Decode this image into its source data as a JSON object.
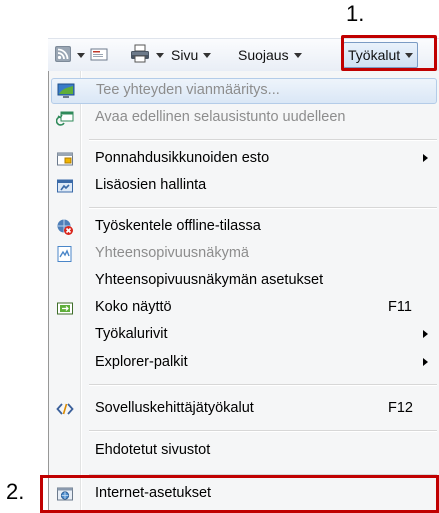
{
  "annotations": {
    "step1": "1.",
    "step2": "2."
  },
  "toolbar": {
    "rss_icon": "feeds-icon",
    "mail_icon": "read-mail-icon",
    "print_icon": "print-icon",
    "page_label": "Sivu",
    "safety_label": "Suojaus",
    "tools_label": "Työkalut"
  },
  "menu": {
    "diagnose": {
      "label": "Tee yhteyden vianmääritys...",
      "icon": "network-diagnose-icon"
    },
    "reopen": {
      "label": "Avaa edellinen selausistunto uudelleen",
      "icon": "reopen-session-icon"
    },
    "popup_blocker": {
      "label": "Ponnahdusikkunoiden esto",
      "icon": "popup-blocker-icon"
    },
    "addons": {
      "label": "Lisäosien hallinta",
      "icon": "manage-addons-icon"
    },
    "offline": {
      "label": "Työskentele offline-tilassa",
      "icon": "offline-icon"
    },
    "compat_view": {
      "label": "Yhteensopivuusnäkymä",
      "icon": "compatibility-view-icon"
    },
    "compat_settings": {
      "label": "Yhteensopivuusnäkymän asetukset"
    },
    "fullscreen": {
      "label": "Koko näyttö",
      "shortcut": "F11",
      "icon": "fullscreen-icon"
    },
    "toolbars": {
      "label": "Työkalurivit"
    },
    "explorer_bars": {
      "label": "Explorer-palkit"
    },
    "devtools": {
      "label": "Sovelluskehittäjätyökalut",
      "shortcut": "F12",
      "icon": "developer-tools-icon"
    },
    "suggested_sites": {
      "label": "Ehdotetut sivustot"
    },
    "internet_options": {
      "label": "Internet-asetukset",
      "icon": "internet-options-icon"
    }
  },
  "colors": {
    "highlight_red": "#c00000",
    "menu_bg": "#f5f6f7",
    "disabled_text": "#8d8d8d"
  }
}
